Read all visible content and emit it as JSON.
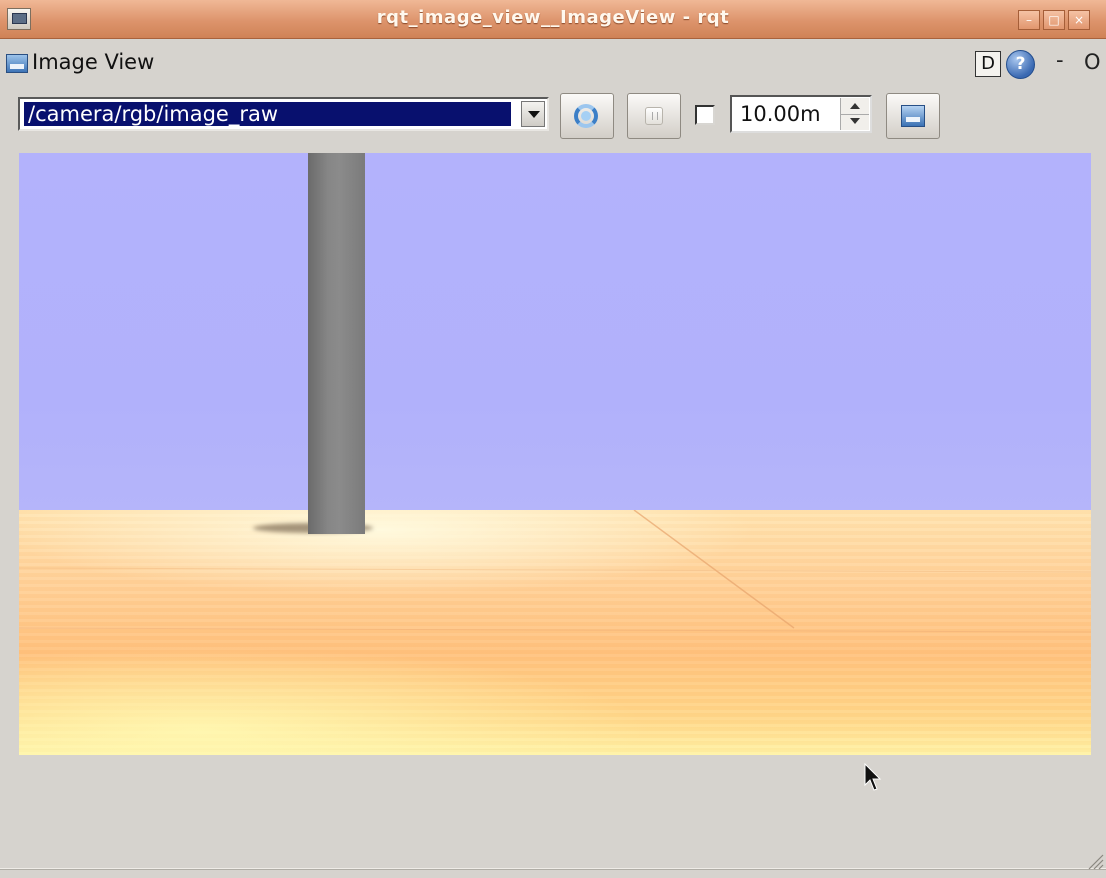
{
  "window": {
    "title": "rqt_image_view__ImageView - rqt",
    "minimize_glyph": "–",
    "maximize_glyph": "□",
    "close_glyph": "×"
  },
  "panel": {
    "title": "Image View",
    "dock_label": "D",
    "help_label": "?",
    "minimize_label": "-",
    "close_label": "O"
  },
  "toolbar": {
    "topic": "/camera/rgb/image_raw",
    "smooth_checked": false,
    "timeout_value": "10.00m"
  },
  "colors": {
    "titlebar": "#dd946c",
    "selection": "#08106e",
    "sky": "#b2b2fb",
    "floor": "#ffc27e",
    "pillar": "#7f7f7f"
  },
  "icons": [
    "window-icon",
    "image-view-icon",
    "refresh-icon",
    "pause-icon",
    "save-image-icon",
    "mouse-cursor-icon"
  ]
}
